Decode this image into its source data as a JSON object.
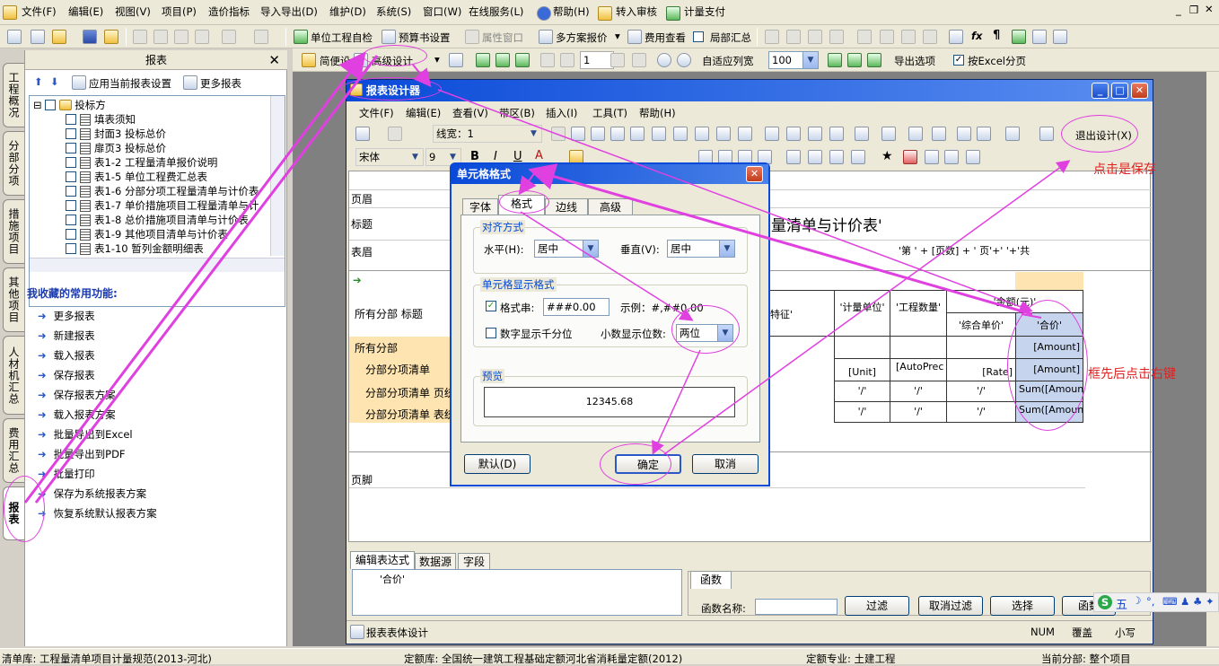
{
  "menu": [
    "文件(F)",
    "编辑(E)",
    "视图(V)",
    "项目(P)",
    "造价指标",
    "导入导出(D)",
    "维护(D)",
    "系统(S)",
    "窗口(W)",
    "在线服务(L)",
    "帮助(H)",
    "转入审核",
    "计量支付"
  ],
  "toolbar1": {
    "self_check": "单位工程自检",
    "budget_settings": "预算书设置",
    "property_window": "属性窗口",
    "multi_quote": "多方案报价",
    "cost_view": "费用查看",
    "local_summary": "局部汇总"
  },
  "toolbar2": {
    "simple": "简便设",
    "advanced": "高级设计",
    "page": "1",
    "fit_width": "自适应列宽",
    "zoom": "100",
    "export_options": "导出选项",
    "excel_paging": "按Excel分页"
  },
  "left_tabs": [
    "工程概况",
    "分部分项",
    "措施项目",
    "其他项目",
    "人材机汇总",
    "费用汇总",
    "报表"
  ],
  "report_panel": {
    "title": "报表",
    "apply_settings": "应用当前报表设置",
    "more_reports": "更多报表",
    "tree_root": "投标方",
    "tree": [
      "填表须知",
      "封面3 投标总价",
      "扉页3 投标总价",
      "表1-2 工程量清单报价说明",
      "表1-5 单位工程费汇总表",
      "表1-6 分部分项工程量清单与计价表",
      "表1-7 单价措施项目工程量清单与计",
      "表1-8 总价措施项目清单与计价表",
      "表1-9 其他项目清单与计价表",
      "表1-10 暂列金额明细表"
    ]
  },
  "favorites": {
    "title": "我收藏的常用功能:",
    "items": [
      "更多报表",
      "新建报表",
      "载入报表",
      "保存报表",
      "保存报表方案",
      "载入报表方案",
      "批量导出到Excel",
      "批量导出到PDF",
      "批量打印",
      "保存为系统报表方案",
      "恢复系统默认报表方案"
    ]
  },
  "designer": {
    "title": "报表设计器",
    "menu": [
      "文件(F)",
      "编辑(E)",
      "查看(V)",
      "带区(B)",
      "插入(I)",
      "工具(T)",
      "帮助(H)"
    ],
    "line_width": "线宽：1",
    "font": "宋体",
    "font_size": "9",
    "exit_design": "退出设计(X)",
    "bands": {
      "header": "页眉",
      "title": "标题",
      "table_head": "表眉",
      "footer": "页脚"
    },
    "title_text": "量清单与计价表'",
    "page_info": "'第 ' + [页数] + ' 页'+' '+'共",
    "rows": [
      "所有分部 标题",
      "所有分部",
      "分部分项清单",
      "分部分项清单 页统",
      "分部分项清单 表统"
    ],
    "col_heads": {
      "feature": "特征'",
      "unit": "'计量单位'",
      "qty": "'工程数量'",
      "amount": "'金额(元)'",
      "unit_price": "'综合单价'",
      "total": "'合价'"
    },
    "cells": {
      "unit": "[Unit]",
      "qty": "[AutoPrec",
      "rate": "[Rate]",
      "amount": "[Amount]",
      "sum1": "Sum([Amount",
      "sum2": "Sum([Amount",
      "slash": "'/'"
    },
    "bottom_tabs": [
      "编辑表达式",
      "数据源",
      "字段"
    ],
    "expr": "'合价'",
    "func": {
      "tab": "函数",
      "name_label": "函数名称:",
      "filter": "过滤",
      "cancel_filter": "取消过滤",
      "select": "选择",
      "more": "函数"
    },
    "status_left": "报表表体设计",
    "status_num": "NUM",
    "status_over": "覆盖",
    "status_lower": "小写"
  },
  "dialog": {
    "title": "单元格格式",
    "tabs": [
      "字体",
      "格式",
      "边线",
      "高级"
    ],
    "align_group": "对齐方式",
    "h_label": "水平(H):",
    "h_value": "居中",
    "v_label": "垂直(V):",
    "v_value": "居中",
    "fmt_group": "单元格显示格式",
    "fmt_label": "格式串:",
    "fmt_value": "###0.00",
    "example": "示例：#,##0.00",
    "thousand": "数字显示千分位",
    "decimal_label": "小数显示位数:",
    "decimal_value": "两位",
    "preview_group": "预览",
    "preview_value": "12345.68",
    "btn_default": "默认(D)",
    "btn_ok": "确定",
    "btn_cancel": "取消"
  },
  "notes": {
    "save": "点击是保存",
    "rightclick": "框先后点击右键"
  },
  "statusbar": {
    "lib": "清单库: 工程量清单项目计量规范(2013-河北)",
    "quota": "定额库: 全国统一建筑工程基础定额河北省消耗量定额(2012)",
    "major": "定额专业: 土建工程",
    "current": "当前分部: 整个项目"
  },
  "ime": {
    "label": "五"
  }
}
